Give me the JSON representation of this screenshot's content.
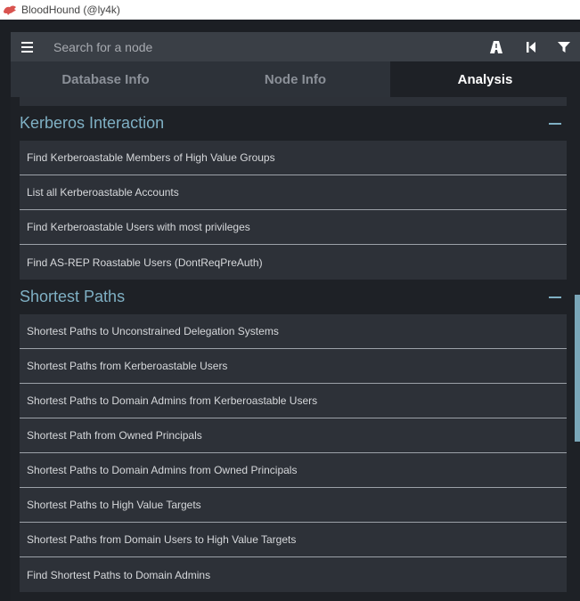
{
  "window": {
    "title": "BloodHound (@ly4k)"
  },
  "search": {
    "placeholder": "Search for a node"
  },
  "toolbar": {
    "icons": [
      "pathfinding-icon",
      "back-icon",
      "filter-icon"
    ]
  },
  "tabs": [
    {
      "label": "Database Info",
      "active": false
    },
    {
      "label": "Node Info",
      "active": false
    },
    {
      "label": "Analysis",
      "active": true
    }
  ],
  "sections": [
    {
      "title": "Kerberos Interaction",
      "queries": [
        "Find Kerberoastable Members of High Value Groups",
        "List all Kerberoastable Accounts",
        "Find Kerberoastable Users with most privileges",
        "Find AS-REP Roastable Users (DontReqPreAuth)"
      ]
    },
    {
      "title": "Shortest Paths",
      "queries": [
        "Shortest Paths to Unconstrained Delegation Systems",
        "Shortest Paths from Kerberoastable Users",
        "Shortest Paths to Domain Admins from Kerberoastable Users",
        "Shortest Path from Owned Principals",
        "Shortest Paths to Domain Admins from Owned Principals",
        "Shortest Paths to High Value Targets",
        "Shortest Paths from Domain Users to High Value Targets",
        "Find Shortest Paths to Domain Admins"
      ]
    }
  ],
  "colors": {
    "accent": "#7fb0c4",
    "panel": "#2d3138",
    "background": "#1e2126",
    "searchbar": "#3a3f46"
  }
}
